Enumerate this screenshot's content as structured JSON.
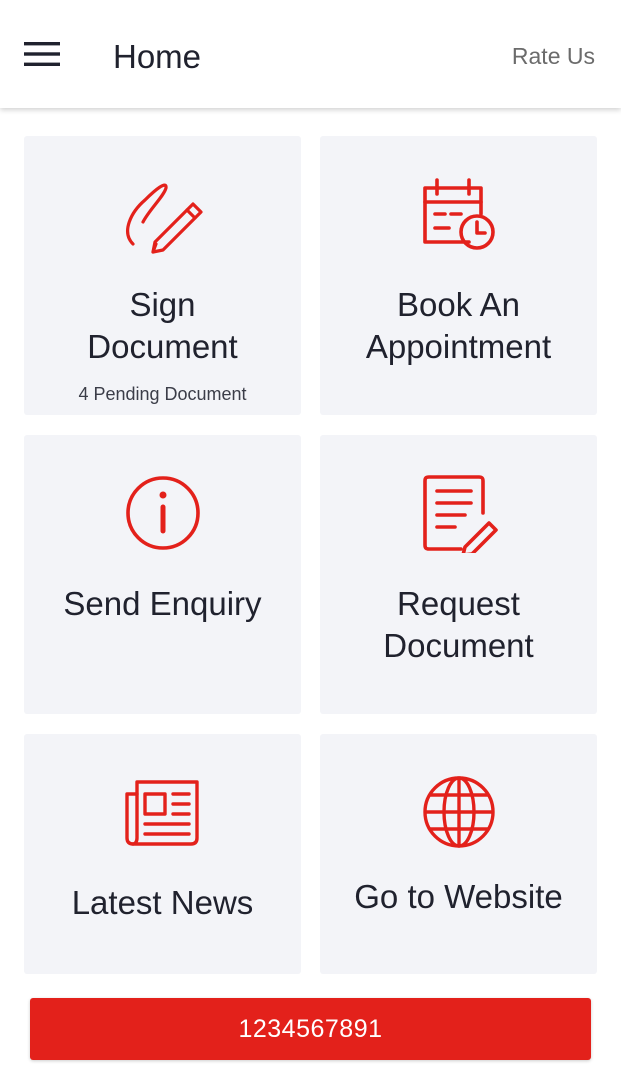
{
  "colors": {
    "accent": "#e3211b",
    "tile_background": "#f3f4f8",
    "text_primary": "#20222e",
    "text_secondary": "#6b6b6b"
  },
  "appbar": {
    "menu_icon": "hamburger-menu-icon",
    "title": "Home",
    "rate_us": "Rate Us"
  },
  "tiles": [
    {
      "icon": "signature-pencil-icon",
      "line1": "Sign",
      "line2": "Document",
      "sub": "4 Pending Document"
    },
    {
      "icon": "calendar-clock-icon",
      "line1": "Book An",
      "line2": "Appointment"
    },
    {
      "icon": "info-icon",
      "line1": "Send Enquiry"
    },
    {
      "icon": "document-edit-icon",
      "line1": "Request",
      "line2": "Document"
    },
    {
      "icon": "newspaper-icon",
      "line1": "Latest News"
    },
    {
      "icon": "globe-icon",
      "line1": "Go to Website"
    }
  ],
  "call_button": {
    "label": "1234567891"
  }
}
